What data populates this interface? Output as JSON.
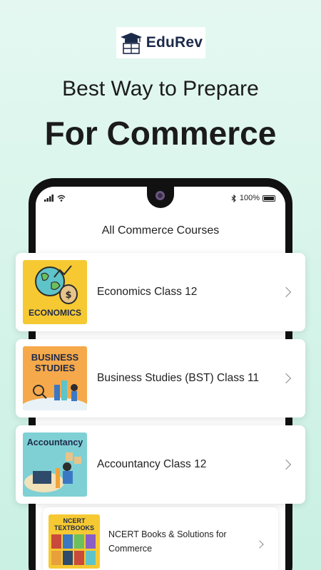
{
  "brand": {
    "name": "EduRev"
  },
  "hero": {
    "tagline": "Best Way to Prepare",
    "headline": "For Commerce"
  },
  "status_bar": {
    "battery": "100%"
  },
  "screen": {
    "title": "All Commerce Courses",
    "courses": [
      {
        "label": "Economics Class 12",
        "thumb_text": "ECONOMICS",
        "thumb_color": "#f6c932"
      },
      {
        "label": "Business Studies (BST) Class 11",
        "thumb_text": "BUSINESS STUDIES",
        "thumb_color": "#f5a94a"
      },
      {
        "label": "Accountancy Class 12",
        "thumb_text": "Accountancy",
        "thumb_color": "#7fd0d4"
      },
      {
        "label": "NCERT Books & Solutions for Commerce",
        "thumb_text": "NCERT TEXTBOOKS",
        "thumb_color": "#f6c932"
      }
    ]
  },
  "colors": {
    "background": "#d5f4ea",
    "text": "#1b1b1b",
    "phone": "#111111"
  }
}
